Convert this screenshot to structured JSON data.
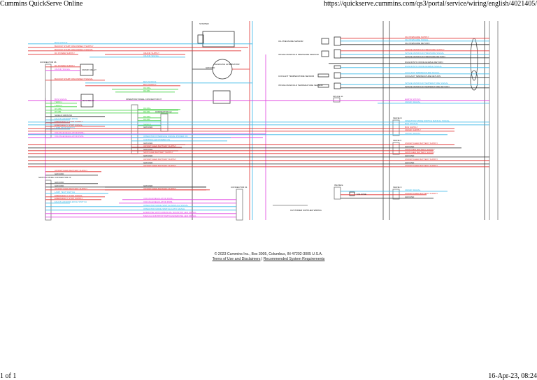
{
  "header": {
    "title": "Cummins QuickServe Online",
    "url": "https://quickserve.cummins.com/qs3/portal/service/wiring/english/4021405/"
  },
  "footer": {
    "page": "1 of 1",
    "datetime": "16-Apr-23, 08:24",
    "copyright": "© 2023 Cummins Inc., Box 3005, Columbus, IN 47202-3005 U.S.A.",
    "terms_link": "Terms of Use and Disclaimers",
    "separator": "|",
    "requirements_link": "Recommended System Requirements"
  },
  "colors": {
    "supply": "#e03030",
    "signal": "#38b8e8",
    "pwm": "#e040e0",
    "comms": "#40d040",
    "ground": "#333333"
  },
  "diagram": {
    "components": {
      "connector_06": "CONNECTOR 06",
      "crank_relay": "CRANK RELAY",
      "bus_relay": "BUS RELAY",
      "operator_panel": "OPERATOR PANEL CONNECTOR 07",
      "connector_12": "CONNECTOR 12",
      "switch_panel": "SWITCH PANEL CONNECTOR 23",
      "connector_01": "CONNECTOR 01",
      "starter": "STARTER",
      "alternator": "CHARGING ALTERNATOR",
      "alt_ground": "GROUND",
      "oil_sensor": "OIL PRESSURE SENSOR",
      "imp_sensor": "INTAKE MANIFOLD PRESSURE SENSOR",
      "coolant_sensor": "COOLANT TEMPERATURE SENSOR",
      "imt_sensor": "INTAKE MANIFOLD TEMPERATURE SENSOR",
      "splice_11": "SPLICE 11",
      "inline_d": "INLINE D",
      "inline_f": "INLINE F",
      "inline_e": "INLINE E",
      "inline_c": "INLINE C",
      "fuse": "10A FUSE",
      "customer_wiring": "CUSTOMER SUPPLIED WIRING"
    },
    "wires": [
      {
        "text": "BUS STATUS"
      },
      {
        "text": "BACKUP START DISCONNECT SUPPLY"
      },
      {
        "text": "BACKUP START DISCONNECT SIGNAL"
      },
      {
        "text": "DC POWER SUPPLY"
      },
      {
        "text": "DC POWER SUPPLY"
      },
      {
        "text": "CRANK SIGNAL"
      },
      {
        "text": "BACKUP START DISCONNECT SIGNAL"
      },
      {
        "text": "CRANK SUPPLY"
      },
      {
        "text": "CRANK SIGNAL"
      },
      {
        "text": "BUS SIGNAL"
      },
      {
        "text": "TERM 1"
      },
      {
        "text": "TERM 2"
      },
      {
        "text": "RS485+"
      },
      {
        "text": "RS485-"
      },
      {
        "text": "SHIELD GROUND"
      },
      {
        "text": "FAULT ACKNOWLEDGE"
      },
      {
        "text": "EMERGENCY STOP SUPPLY"
      },
      {
        "text": "EMERGENCY STOP SIGNAL"
      },
      {
        "text": "LAMP TEST SWITCH"
      },
      {
        "text": "VOLTAGE REGULATOR PWM+"
      },
      {
        "text": "VOLTAGE REGULATOR PWM-"
      },
      {
        "text": "BUS STATUS"
      },
      {
        "text": "BUS SUPPLY"
      },
      {
        "text": "RS485+"
      },
      {
        "text": "RS485-"
      },
      {
        "text": "RS485+"
      },
      {
        "text": "RS485-"
      },
      {
        "text": "RS485+"
      },
      {
        "text": "RS485-"
      },
      {
        "text": "SHIELD"
      },
      {
        "text": "GROUND"
      },
      {
        "text": "OPERATOR INTERFACE SIGNAL POWER ON"
      },
      {
        "text": "CONTROLLER POWER ON"
      },
      {
        "text": "GROUND"
      },
      {
        "text": "UNSWITCHED BATTERY SUPPLY"
      },
      {
        "text": "GROUND"
      },
      {
        "text": "SWITCHED BATTERY SUPPLY"
      },
      {
        "text": "GROUND"
      },
      {
        "text": "UNSWITCHED BATTERY SUPPLY"
      },
      {
        "text": "GROUND"
      },
      {
        "text": "UNSWITCHED BATTERY SUPPLY"
      },
      {
        "text": "UNSWITCHED BATTERY SUPPLY"
      },
      {
        "text": "GROUND"
      },
      {
        "text": "GROUND"
      },
      {
        "text": "GROUND"
      },
      {
        "text": "UNSWITCHED BATTERY SUPPLY"
      },
      {
        "text": "LAMP TEST SWITCH"
      },
      {
        "text": "EMERGENCY STOP SIGNAL"
      },
      {
        "text": "EMERGENCY STOP SUPPLY"
      },
      {
        "text": "FAULT ACKNOWLEDGE SWITCH"
      },
      {
        "text": "GROUND"
      },
      {
        "text": "UNSWITCHED BATTERY SUPPLY"
      },
      {
        "text": "VOLTAGE REGULATOR PWM+"
      },
      {
        "text": "VOLTAGE REGULATOR PWM-"
      },
      {
        "text": "OPERATOR MODE SWITCH MANUAL SIGNAL"
      },
      {
        "text": "OPERATOR MODE SWITCH AUTO SIGNAL"
      },
      {
        "text": "EXERCISE SWITCH/MANUAL RUN/STOP LED SIGNAL"
      },
      {
        "text": "MANUAL RUN/STOP SWITCH/EXERCISE LED SIGNAL"
      },
      {
        "text": "OIL PRESSURE SUPPLY"
      },
      {
        "text": "OIL PRESSURE SIGNAL"
      },
      {
        "text": "OIL PRESSURE RETURN"
      },
      {
        "text": "INTAKE MANIFOLD PRESSURE SUPPLY"
      },
      {
        "text": "INTAKE MANIFOLD PRESSURE SIGNAL"
      },
      {
        "text": "INTAKE MANIFOLD PRESSURE RETURN"
      },
      {
        "text": "DIAGNOSTIC MODE ENABLE RETURN"
      },
      {
        "text": "DIAGNOSTIC MODE ENABLE SIGNAL"
      },
      {
        "text": "COOLANT TEMPERATURE SIGNAL"
      },
      {
        "text": "COOLANT TEMPERATURE RETURN"
      },
      {
        "text": "INTAKE MANIFOLD TEMPERATURE SIGNAL"
      },
      {
        "text": "INTAKE MANIFOLD TEMPERATURE RETURN"
      },
      {
        "text": "EARTH STATUS"
      },
      {
        "text": "CRANK SIGNAL"
      },
      {
        "text": "OPERATOR MODE SWITCH MANUAL SIGNAL"
      },
      {
        "text": "BUS STATUS"
      },
      {
        "text": "BUS SUPPLY"
      },
      {
        "text": "CRANK SUPPLY"
      },
      {
        "text": "CRANK SIGNAL"
      },
      {
        "text": "UNSWITCHED BATTERY SUPPLY"
      },
      {
        "text": "GROUND"
      },
      {
        "text": "SWITCHED BATTERY SUPPLY"
      },
      {
        "text": "SWITCHED BATTERY SUPPLY"
      },
      {
        "text": "GROUND"
      },
      {
        "text": "UNSWITCHED BATTERY SUPPLY"
      },
      {
        "text": "GROUND"
      },
      {
        "text": "UNSWITCHED BATTERY SUPPLY"
      },
      {
        "text": "CRANK SIGNAL"
      },
      {
        "text": "UNSWITCHED BATTERY SUPPLY"
      },
      {
        "text": "GROUND"
      }
    ]
  }
}
